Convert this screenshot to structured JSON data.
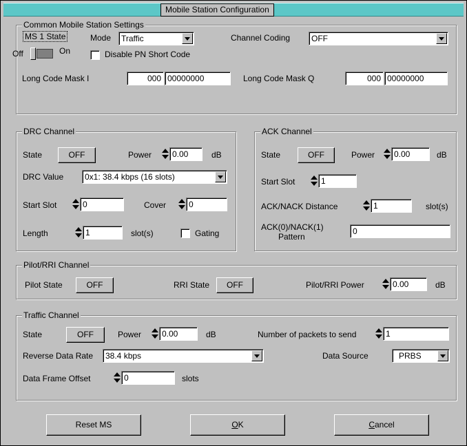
{
  "window": {
    "title": "Mobile Station Configuration"
  },
  "common": {
    "legend": "Common Mobile Station Settings",
    "ms_state_label": "MS 1 State",
    "off_label": "Off",
    "on_label": "On",
    "toggle_state": "off",
    "mode_label": "Mode",
    "mode_value": "Traffic",
    "channel_coding_label": "Channel Coding",
    "channel_coding_value": "OFF",
    "disable_pn_label": "Disable PN Short Code",
    "disable_pn_checked": false,
    "long_code_i_label": "Long Code Mask I",
    "long_code_i_hi": "000",
    "long_code_i_lo": "00000000",
    "long_code_q_label": "Long Code Mask Q",
    "long_code_q_hi": "000",
    "long_code_q_lo": "00000000"
  },
  "drc": {
    "legend": "DRC Channel",
    "state_label": "State",
    "state_value": "OFF",
    "power_label": "Power",
    "power_value": "0.00",
    "power_unit": "dB",
    "drc_value_label": "DRC Value",
    "drc_value": "0x1: 38.4 kbps (16 slots)",
    "start_slot_label": "Start Slot",
    "start_slot_value": "0",
    "cover_label": "Cover",
    "cover_value": "0",
    "length_label": "Length",
    "length_value": "1",
    "length_unit": "slot(s)",
    "gating_label": "Gating",
    "gating_checked": false
  },
  "ack": {
    "legend": "ACK Channel",
    "state_label": "State",
    "state_value": "OFF",
    "power_label": "Power",
    "power_value": "0.00",
    "power_unit": "dB",
    "start_slot_label": "Start Slot",
    "start_slot_value": "1",
    "distance_label": "ACK/NACK Distance",
    "distance_value": "1",
    "distance_unit": "slot(s)",
    "pattern_label_1": "ACK(0)/NACK(1)",
    "pattern_label_2": "Pattern",
    "pattern_value": "0"
  },
  "pilot": {
    "legend": "Pilot/RRI Channel",
    "pilot_state_label": "Pilot State",
    "pilot_state_value": "OFF",
    "rri_state_label": "RRI State",
    "rri_state_value": "OFF",
    "power_label": "Pilot/RRI Power",
    "power_value": "0.00",
    "power_unit": "dB"
  },
  "traffic": {
    "legend": "Traffic Channel",
    "state_label": "State",
    "state_value": "OFF",
    "power_label": "Power",
    "power_value": "0.00",
    "power_unit": "dB",
    "packets_label": "Number of packets to send",
    "packets_value": "1",
    "rate_label": "Reverse Data Rate",
    "rate_value": "38.4 kbps",
    "source_label": "Data Source",
    "source_value": "PRBS",
    "offset_label": "Data Frame Offset",
    "offset_value": "0",
    "offset_unit": "slots"
  },
  "buttons": {
    "reset_pre": "Reset MS",
    "ok_u": "O",
    "ok_rest": "K",
    "cancel_u": "C",
    "cancel_rest": "ancel"
  },
  "colors": {
    "titlebar": "#5cc7c7",
    "dialog": "#c0c0c0"
  }
}
